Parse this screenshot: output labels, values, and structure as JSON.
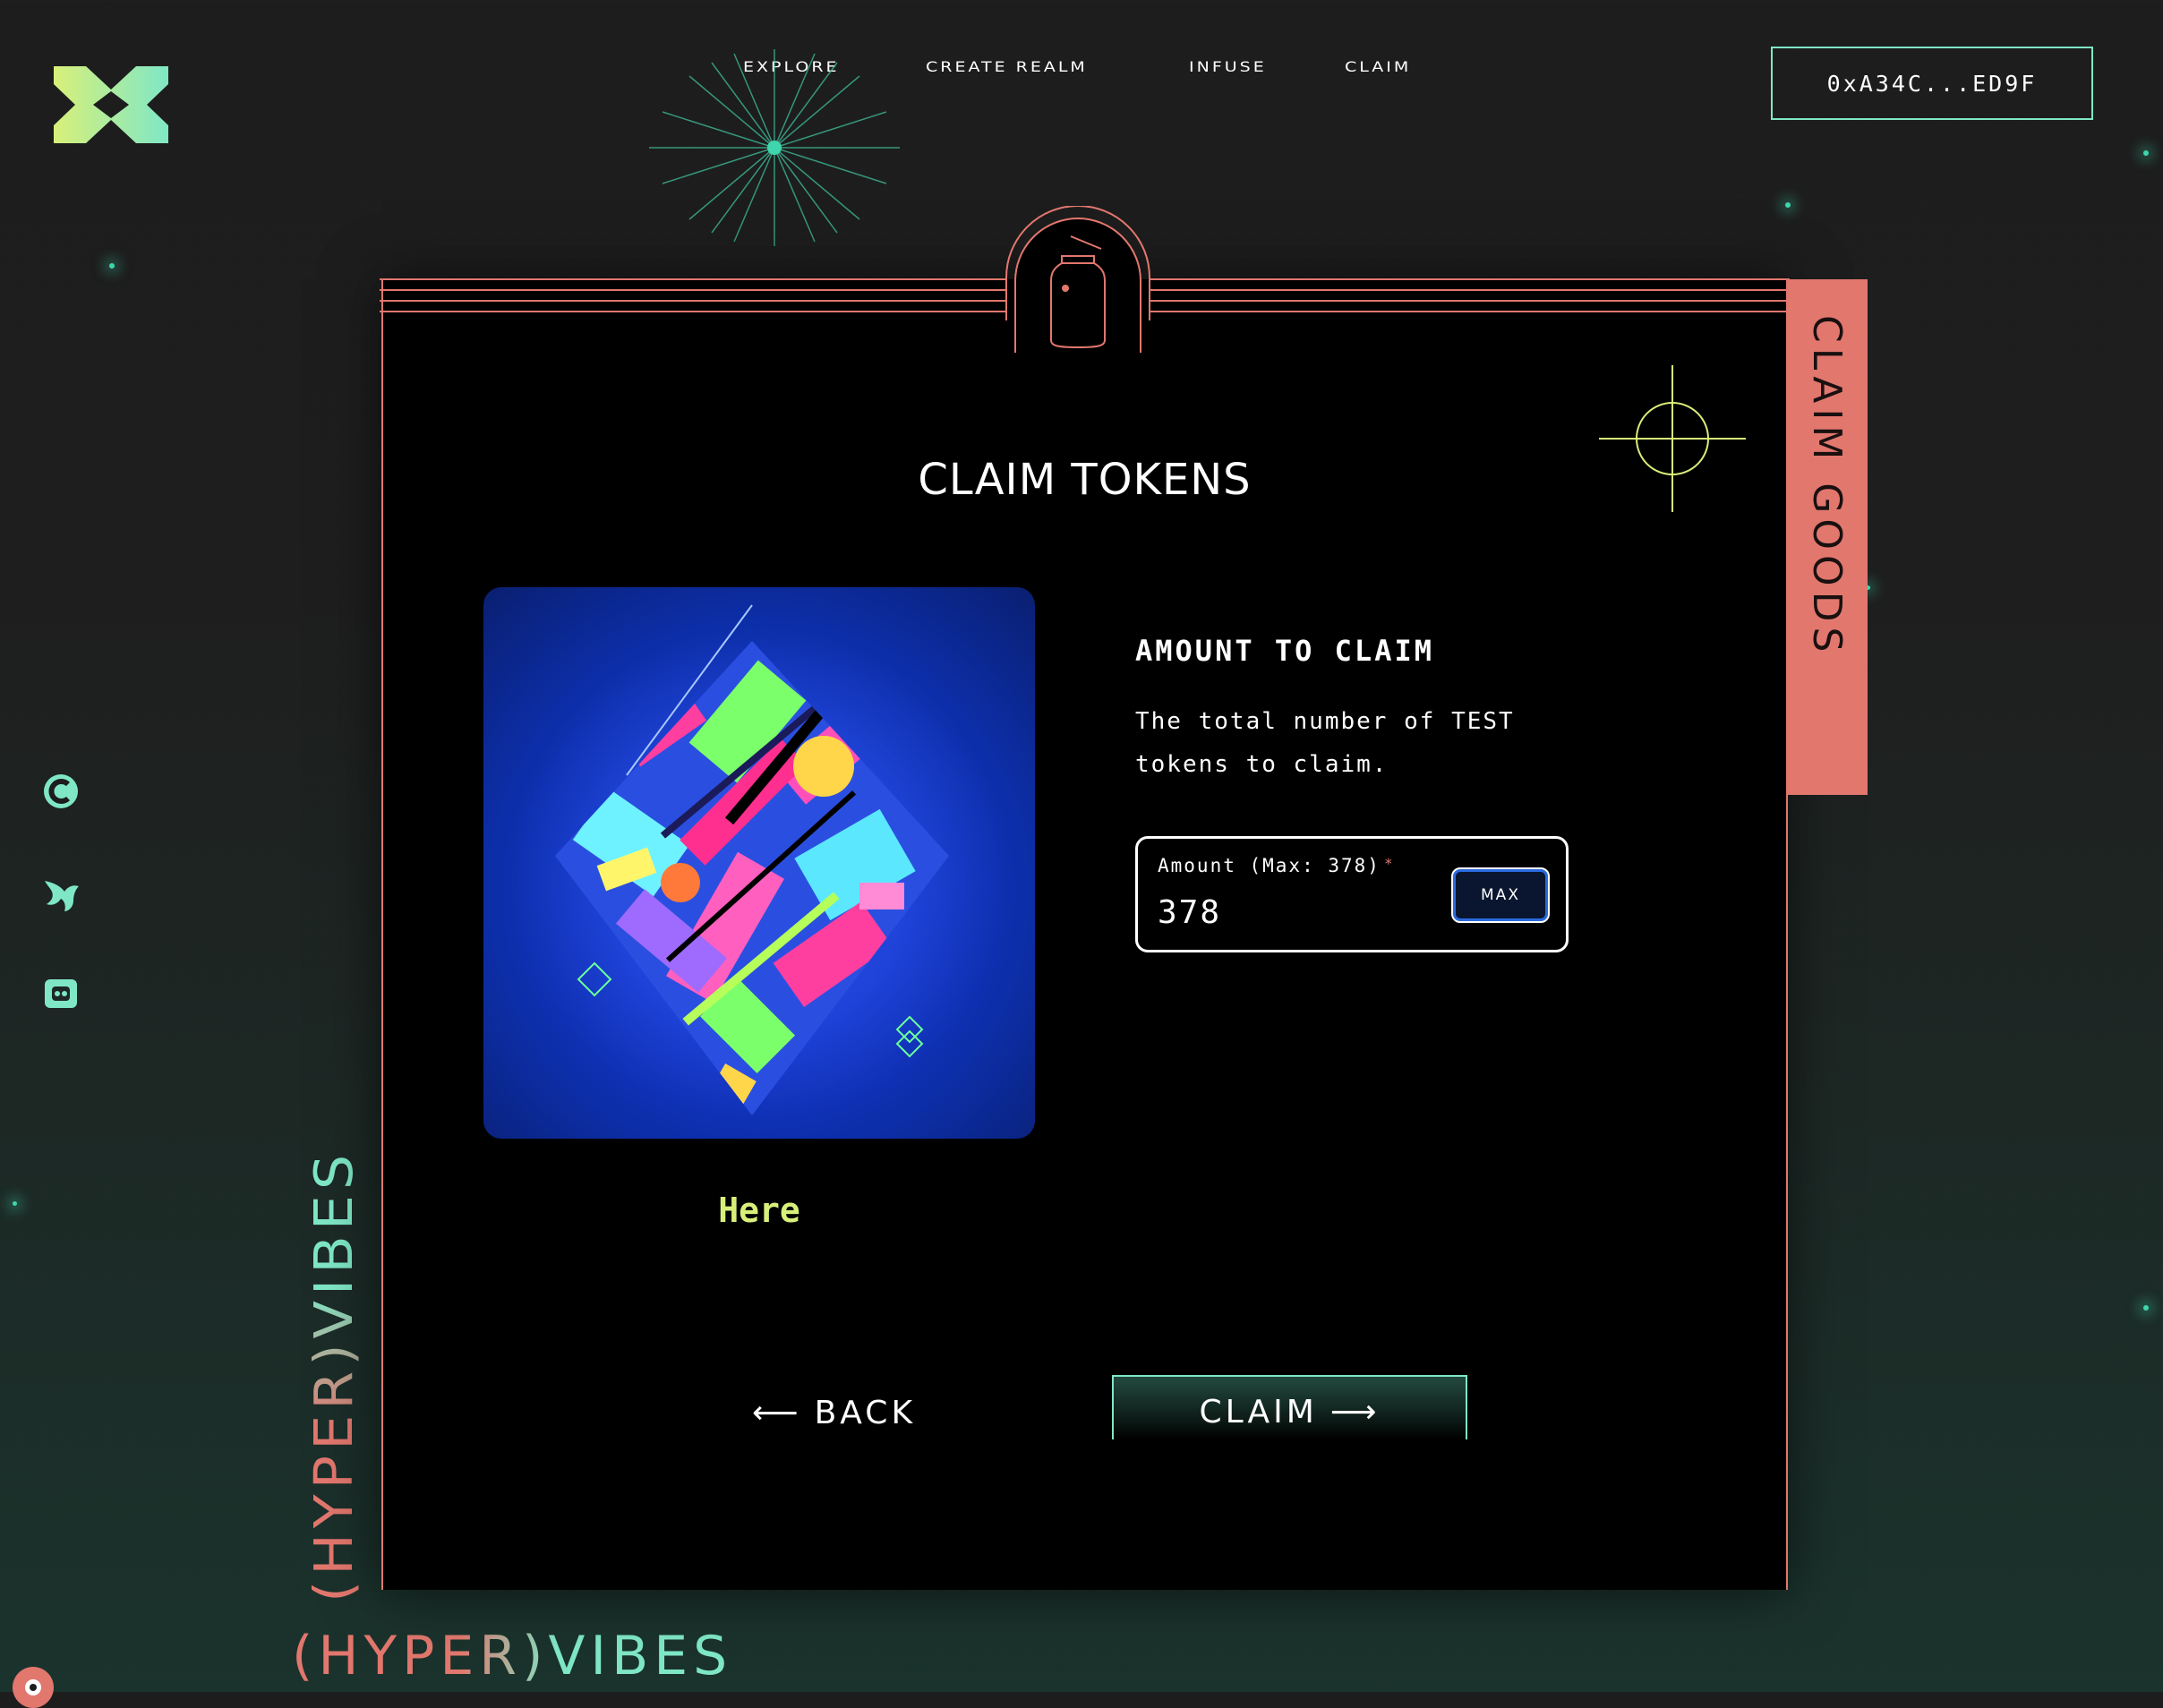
{
  "header": {
    "logo_name": "hypervibes-logo",
    "nav": [
      {
        "label": "EXPLORE"
      },
      {
        "label": "CREATE REALM"
      },
      {
        "label": "INFUSE"
      },
      {
        "label": "CLAIM"
      }
    ],
    "wallet_address": "0xA34C...ED9F"
  },
  "social_icons": [
    "coin-icon",
    "bird-icon",
    "discord-icon"
  ],
  "brand": {
    "vertical_text": "(HYPER)VIBES",
    "horizontal_text": "(HYPER)VIBES"
  },
  "card": {
    "side_tab_label": "CLAIM GOODS",
    "title": "CLAIM TOKENS",
    "artwork_caption": "Here",
    "amount": {
      "heading": "AMOUNT TO CLAIM",
      "description": "The total number of TEST tokens to claim.",
      "field_label": "Amount (Max: 378)",
      "required_marker": "*",
      "value": "378",
      "max_button": "MAX"
    },
    "back_label": "BACK",
    "back_arrow": "⟵",
    "claim_label": "CLAIM",
    "claim_arrow": "⟶"
  },
  "colors": {
    "accent_coral": "#e2776e",
    "accent_mint": "#7fe7c6",
    "accent_lime": "#d8f07a",
    "card_bg": "#000000"
  }
}
